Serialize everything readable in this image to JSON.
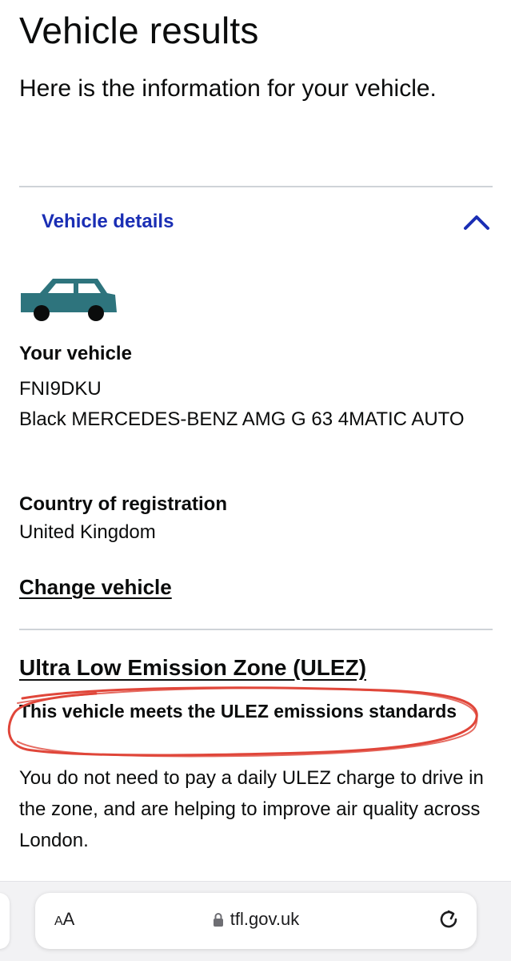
{
  "page": {
    "title": "Vehicle results",
    "intro": "Here is the information for your vehicle."
  },
  "details": {
    "heading": "Vehicle details",
    "expanded": true,
    "vehicle_label": "Your vehicle",
    "registration": "FNI9DKU",
    "description": "Black MERCEDES-BENZ AMG G 63 4MATIC AUTO",
    "country_label": "Country of registration",
    "country": "United Kingdom",
    "change_link": "Change vehicle"
  },
  "ulez": {
    "heading": "Ultra Low Emission Zone (ULEZ)",
    "status": "This vehicle meets the ULEZ emissions standards",
    "body": "You do not need to pay a daily ULEZ charge to drive in the zone, and are helping to improve air quality across London."
  },
  "browser": {
    "aa_small": "A",
    "aa_large": "A",
    "url": "tfl.gov.uk"
  },
  "colors": {
    "link_blue": "#1a2eb4",
    "car_teal": "#2e747d",
    "annotation_red": "#e0463a"
  },
  "icons": {
    "chevron": "chevron-up-icon",
    "car": "car-icon",
    "lock": "lock-icon",
    "reload": "reload-icon"
  }
}
